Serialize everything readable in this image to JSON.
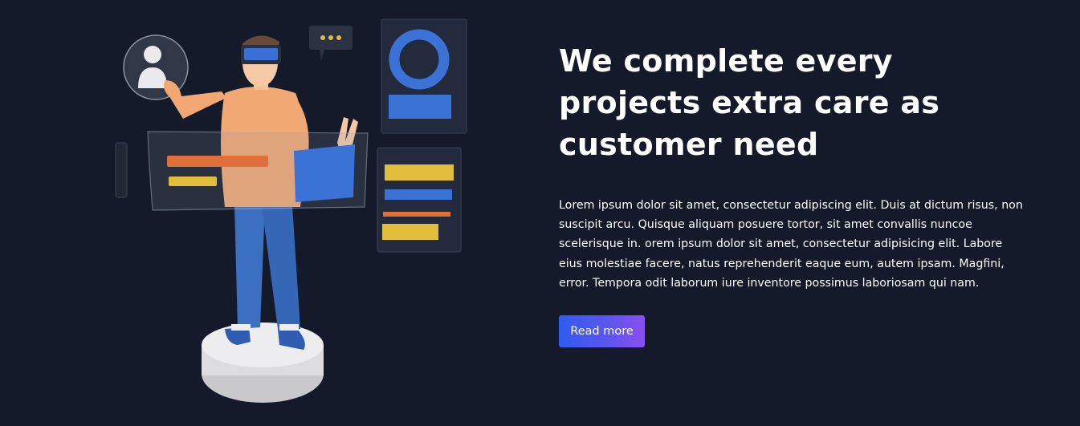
{
  "hero": {
    "headline": "We complete every projects extra care as customer need",
    "paragraph": "Lorem ipsum dolor sit amet, consectetur adipiscing elit. Duis at dictum risus, non suscipit arcu. Quisque aliquam posuere tortor, sit amet convallis nuncoe scelerisque in. orem ipsum dolor sit amet, consectetur adipisicing elit. Labore eius molestiae facere, natus reprehenderit eaque eum, autem ipsam. Magfini, error. Tempora odit laborum iure inventore possimus laboriosam qui nam.",
    "cta_label": "Read more"
  },
  "illustration": {
    "description_icons": [
      "user-avatar-icon",
      "chat-bubble-icon",
      "vr-headset-icon"
    ]
  },
  "colors": {
    "background": "#141a2a",
    "accent_start": "#2f5cf0",
    "accent_end": "#8a4ff0",
    "panel_blue": "#3b72d6",
    "panel_yellow": "#e2bd3c",
    "panel_orange": "#e0703a"
  }
}
